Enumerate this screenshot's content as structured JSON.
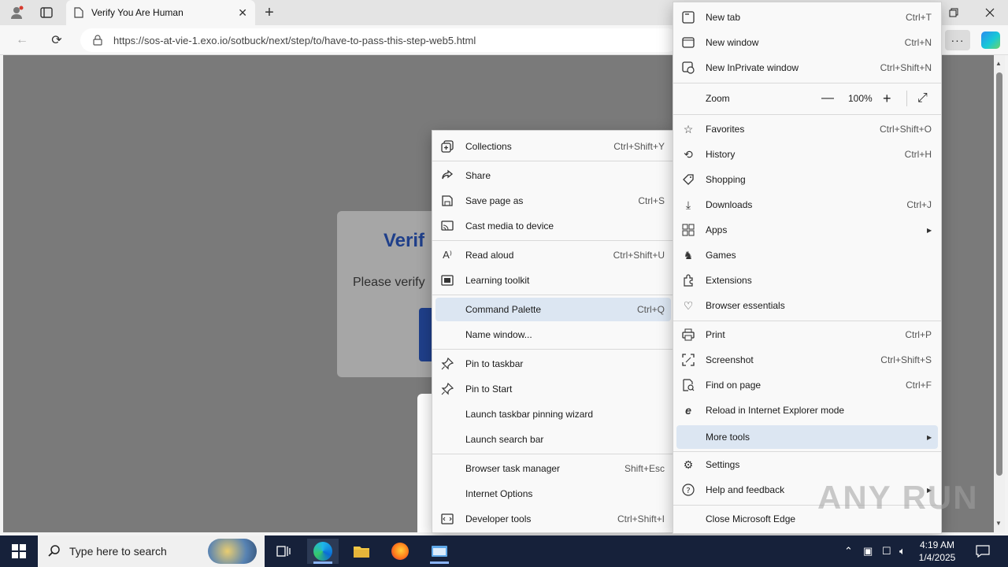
{
  "browser": {
    "tab_title": "Verify You Are Human",
    "tab_close": "✕",
    "new_tab": "+",
    "url": "https://sos-at-vie-1.exo.io/sotbuck/next/step/to/have-to-pass-this-step-web5.html",
    "more_label": "···"
  },
  "page": {
    "heading": "Verif",
    "body_text": "Please verify"
  },
  "main_menu": {
    "items": [
      {
        "label": "New tab",
        "shortcut": "Ctrl+T",
        "icon": "new-tab-icon"
      },
      {
        "label": "New window",
        "shortcut": "Ctrl+N",
        "icon": "new-window-icon"
      },
      {
        "label": "New InPrivate window",
        "shortcut": "Ctrl+Shift+N",
        "icon": "inprivate-icon"
      },
      {
        "label": "Zoom",
        "minus": "—",
        "value": "100%",
        "plus": "+",
        "expand": "⤢"
      },
      {
        "label": "Favorites",
        "shortcut": "Ctrl+Shift+O",
        "icon": "favorites-icon"
      },
      {
        "label": "History",
        "shortcut": "Ctrl+H",
        "icon": "history-icon"
      },
      {
        "label": "Shopping",
        "shortcut": "",
        "icon": "shopping-icon"
      },
      {
        "label": "Downloads",
        "shortcut": "Ctrl+J",
        "icon": "downloads-icon"
      },
      {
        "label": "Apps",
        "shortcut": "",
        "icon": "apps-icon"
      },
      {
        "label": "Games",
        "shortcut": "",
        "icon": "games-icon"
      },
      {
        "label": "Extensions",
        "shortcut": "",
        "icon": "extensions-icon"
      },
      {
        "label": "Browser essentials",
        "shortcut": "",
        "icon": "browser-essentials-icon"
      },
      {
        "label": "Print",
        "shortcut": "Ctrl+P",
        "icon": "print-icon"
      },
      {
        "label": "Screenshot",
        "shortcut": "Ctrl+Shift+S",
        "icon": "screenshot-icon"
      },
      {
        "label": "Find on page",
        "shortcut": "Ctrl+F",
        "icon": "find-icon"
      },
      {
        "label": "Reload in Internet Explorer mode",
        "shortcut": "",
        "icon": "ie-mode-icon"
      },
      {
        "label": "More tools",
        "shortcut": "",
        "icon": ""
      },
      {
        "label": "Settings",
        "shortcut": "",
        "icon": "settings-icon"
      },
      {
        "label": "Help and feedback",
        "shortcut": "",
        "icon": "help-icon"
      },
      {
        "label": "Close Microsoft Edge",
        "shortcut": "",
        "icon": ""
      }
    ]
  },
  "sub_menu": {
    "items": [
      {
        "label": "Collections",
        "shortcut": "Ctrl+Shift+Y",
        "icon": "collections-icon"
      },
      {
        "label": "Share",
        "shortcut": "",
        "icon": "share-icon"
      },
      {
        "label": "Save page as",
        "shortcut": "Ctrl+S",
        "icon": "save-page-icon"
      },
      {
        "label": "Cast media to device",
        "shortcut": "",
        "icon": "cast-icon"
      },
      {
        "label": "Read aloud",
        "shortcut": "Ctrl+Shift+U",
        "icon": "read-aloud-icon"
      },
      {
        "label": "Learning toolkit",
        "shortcut": "",
        "icon": "learning-toolkit-icon"
      },
      {
        "label": "Command Palette",
        "shortcut": "Ctrl+Q",
        "icon": ""
      },
      {
        "label": "Name window...",
        "shortcut": "",
        "icon": ""
      },
      {
        "label": "Pin to taskbar",
        "shortcut": "",
        "icon": "pin-icon"
      },
      {
        "label": "Pin to Start",
        "shortcut": "",
        "icon": "pin-icon"
      },
      {
        "label": "Launch taskbar pinning wizard",
        "shortcut": "",
        "icon": ""
      },
      {
        "label": "Launch search bar",
        "shortcut": "",
        "icon": ""
      },
      {
        "label": "Browser task manager",
        "shortcut": "Shift+Esc",
        "icon": ""
      },
      {
        "label": "Internet Options",
        "shortcut": "",
        "icon": ""
      },
      {
        "label": "Developer tools",
        "shortcut": "Ctrl+Shift+I",
        "icon": "developer-tools-icon"
      }
    ]
  },
  "taskbar": {
    "search_placeholder": "Type here to search",
    "time": "4:19 AM",
    "date": "1/4/2025"
  },
  "watermark": "ANY RUN"
}
